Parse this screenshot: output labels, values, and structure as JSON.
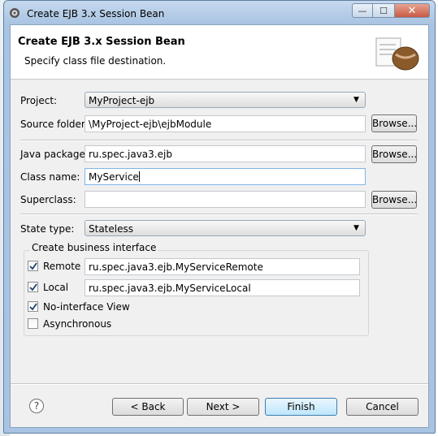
{
  "window": {
    "title": "Create EJB 3.x Session Bean",
    "buttons": {
      "minimize": "—",
      "maximize": "☐",
      "close": "✕"
    }
  },
  "banner": {
    "title": "Create EJB 3.x Session Bean",
    "description": "Specify class file destination.",
    "icon": "coffee-bean-icon"
  },
  "form": {
    "project_label": "Project:",
    "project_value": "MyProject-ejb",
    "source_folder_label": "Source folder:",
    "source_folder_value": "\\MyProject-ejb\\ejbModule",
    "java_package_label": "Java package:",
    "java_package_value": "ru.spec.java3.ejb",
    "class_name_label": "Class name:",
    "class_name_value": "MyService",
    "superclass_label": "Superclass:",
    "superclass_value": "",
    "browse_label": "Browse...",
    "state_type_label": "State type:",
    "state_type_value": "Stateless"
  },
  "business_interface": {
    "legend": "Create business interface",
    "remote_label": "Remote",
    "remote_checked": true,
    "remote_value": "ru.spec.java3.ejb.MyServiceRemote",
    "local_label": "Local",
    "local_checked": true,
    "local_value": "ru.spec.java3.ejb.MyServiceLocal",
    "no_interface_label": "No-interface View",
    "no_interface_checked": true,
    "async_label": "Asynchronous",
    "async_checked": false
  },
  "footer": {
    "help": "?",
    "back": "< Back",
    "next": "Next >",
    "finish": "Finish",
    "cancel": "Cancel"
  }
}
